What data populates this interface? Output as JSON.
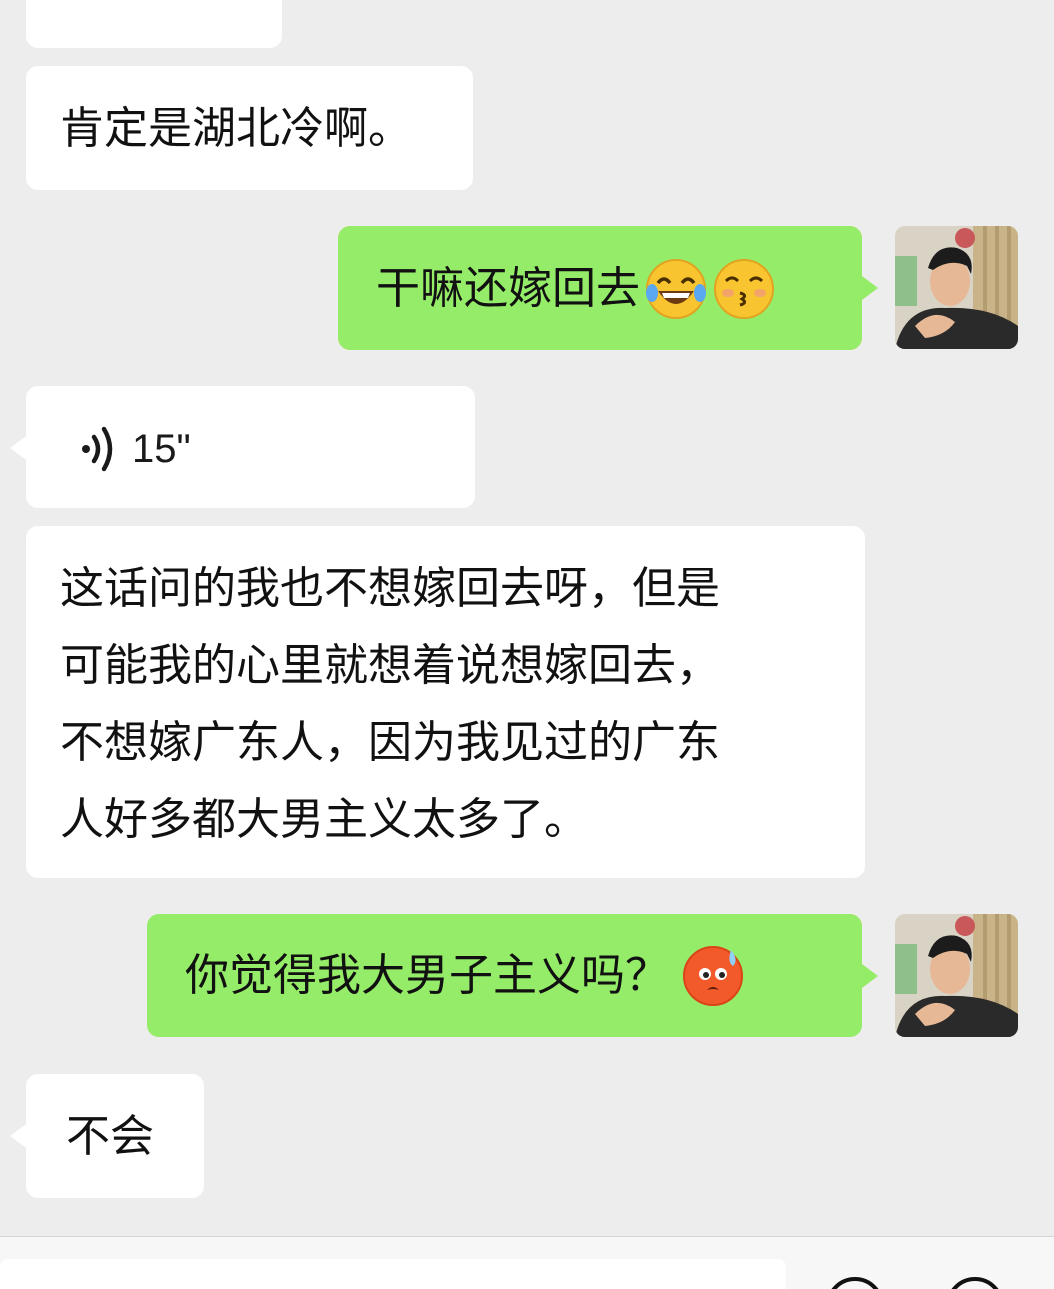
{
  "messages": [
    {
      "side": "left",
      "type": "text",
      "text": "肯定是湖北冷啊。"
    },
    {
      "side": "right",
      "type": "text",
      "text": "干嘛还嫁回去",
      "emojis": [
        "joy-tears-emoji",
        "kissing-emoji"
      ]
    },
    {
      "side": "left",
      "type": "voice",
      "duration": "15\""
    },
    {
      "side": "left",
      "type": "text",
      "lines": [
        "这话问的我也不想嫁回去呀，但是",
        "可能我的心里就想着说想嫁回去，",
        "不想嫁广东人，因为我见过的广东",
        "人好多都大男主义太多了。"
      ]
    },
    {
      "side": "right",
      "type": "text",
      "text": "你觉得我大男子主义吗？",
      "emojis": [
        "hot-face-sweat-emoji"
      ]
    },
    {
      "side": "left",
      "type": "text",
      "text": "不会"
    }
  ],
  "colors": {
    "background": "#ededed",
    "received_bubble": "#ffffff",
    "sent_bubble": "#95ec69",
    "text": "#111111"
  }
}
